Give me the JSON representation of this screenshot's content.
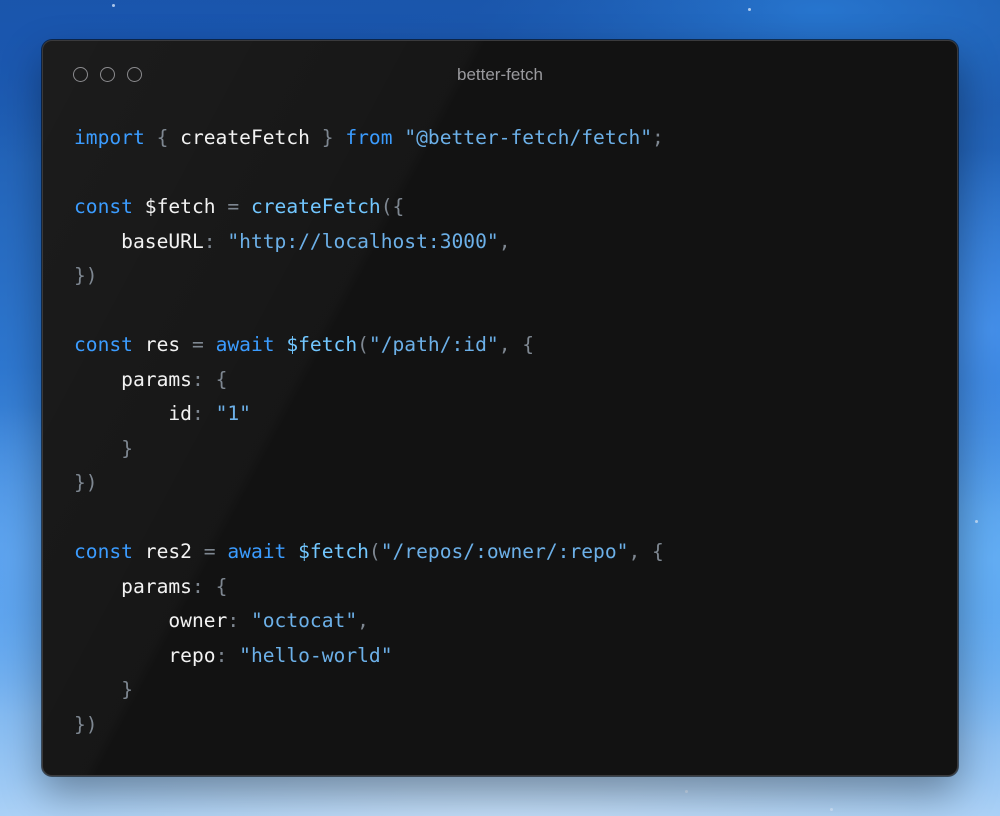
{
  "window": {
    "title": "better-fetch",
    "buttons": [
      "close",
      "minimize",
      "maximize"
    ]
  },
  "colors": {
    "keyword": "#3b9cff",
    "function": "#72c7ff",
    "string": "#6cb0e8",
    "punctuation": "#7e8791",
    "identifier": "#f2f2f2",
    "window_background": "#121212"
  },
  "code": {
    "language": "typescript",
    "lines": [
      [
        {
          "t": "import",
          "c": "kw"
        },
        {
          "t": " ",
          "c": "var"
        },
        {
          "t": "{",
          "c": "pun"
        },
        {
          "t": " createFetch ",
          "c": "var"
        },
        {
          "t": "}",
          "c": "pun"
        },
        {
          "t": " ",
          "c": "var"
        },
        {
          "t": "from",
          "c": "kw"
        },
        {
          "t": " ",
          "c": "var"
        },
        {
          "t": "\"@better-fetch/fetch\"",
          "c": "str"
        },
        {
          "t": ";",
          "c": "pun"
        }
      ],
      [],
      [
        {
          "t": "const",
          "c": "kw"
        },
        {
          "t": " $fetch ",
          "c": "var"
        },
        {
          "t": "=",
          "c": "pun"
        },
        {
          "t": " ",
          "c": "var"
        },
        {
          "t": "createFetch",
          "c": "fn"
        },
        {
          "t": "({",
          "c": "pun"
        }
      ],
      [
        {
          "t": "    baseURL",
          "c": "var"
        },
        {
          "t": ":",
          "c": "pun"
        },
        {
          "t": " ",
          "c": "var"
        },
        {
          "t": "\"http://localhost:3000\"",
          "c": "str"
        },
        {
          "t": ",",
          "c": "pun"
        }
      ],
      [
        {
          "t": "})",
          "c": "pun"
        }
      ],
      [],
      [
        {
          "t": "const",
          "c": "kw"
        },
        {
          "t": " res ",
          "c": "var"
        },
        {
          "t": "=",
          "c": "pun"
        },
        {
          "t": " ",
          "c": "var"
        },
        {
          "t": "await",
          "c": "kw"
        },
        {
          "t": " ",
          "c": "var"
        },
        {
          "t": "$fetch",
          "c": "fn"
        },
        {
          "t": "(",
          "c": "pun"
        },
        {
          "t": "\"/path/:id\"",
          "c": "str"
        },
        {
          "t": ",",
          "c": "pun"
        },
        {
          "t": " ",
          "c": "var"
        },
        {
          "t": "{",
          "c": "pun"
        }
      ],
      [
        {
          "t": "    params",
          "c": "var"
        },
        {
          "t": ":",
          "c": "pun"
        },
        {
          "t": " ",
          "c": "var"
        },
        {
          "t": "{",
          "c": "pun"
        }
      ],
      [
        {
          "t": "        id",
          "c": "var"
        },
        {
          "t": ":",
          "c": "pun"
        },
        {
          "t": " ",
          "c": "var"
        },
        {
          "t": "\"1\"",
          "c": "str"
        }
      ],
      [
        {
          "t": "    ",
          "c": "var"
        },
        {
          "t": "}",
          "c": "pun"
        }
      ],
      [
        {
          "t": "})",
          "c": "pun"
        }
      ],
      [],
      [
        {
          "t": "const",
          "c": "kw"
        },
        {
          "t": " res2 ",
          "c": "var"
        },
        {
          "t": "=",
          "c": "pun"
        },
        {
          "t": " ",
          "c": "var"
        },
        {
          "t": "await",
          "c": "kw"
        },
        {
          "t": " ",
          "c": "var"
        },
        {
          "t": "$fetch",
          "c": "fn"
        },
        {
          "t": "(",
          "c": "pun"
        },
        {
          "t": "\"/repos/:owner/:repo\"",
          "c": "str"
        },
        {
          "t": ",",
          "c": "pun"
        },
        {
          "t": " ",
          "c": "var"
        },
        {
          "t": "{",
          "c": "pun"
        }
      ],
      [
        {
          "t": "    params",
          "c": "var"
        },
        {
          "t": ":",
          "c": "pun"
        },
        {
          "t": " ",
          "c": "var"
        },
        {
          "t": "{",
          "c": "pun"
        }
      ],
      [
        {
          "t": "        owner",
          "c": "var"
        },
        {
          "t": ":",
          "c": "pun"
        },
        {
          "t": " ",
          "c": "var"
        },
        {
          "t": "\"octocat\"",
          "c": "str"
        },
        {
          "t": ",",
          "c": "pun"
        }
      ],
      [
        {
          "t": "        repo",
          "c": "var"
        },
        {
          "t": ":",
          "c": "pun"
        },
        {
          "t": " ",
          "c": "var"
        },
        {
          "t": "\"hello-world\"",
          "c": "str"
        }
      ],
      [
        {
          "t": "    ",
          "c": "var"
        },
        {
          "t": "}",
          "c": "pun"
        }
      ],
      [
        {
          "t": "})",
          "c": "pun"
        }
      ]
    ]
  }
}
